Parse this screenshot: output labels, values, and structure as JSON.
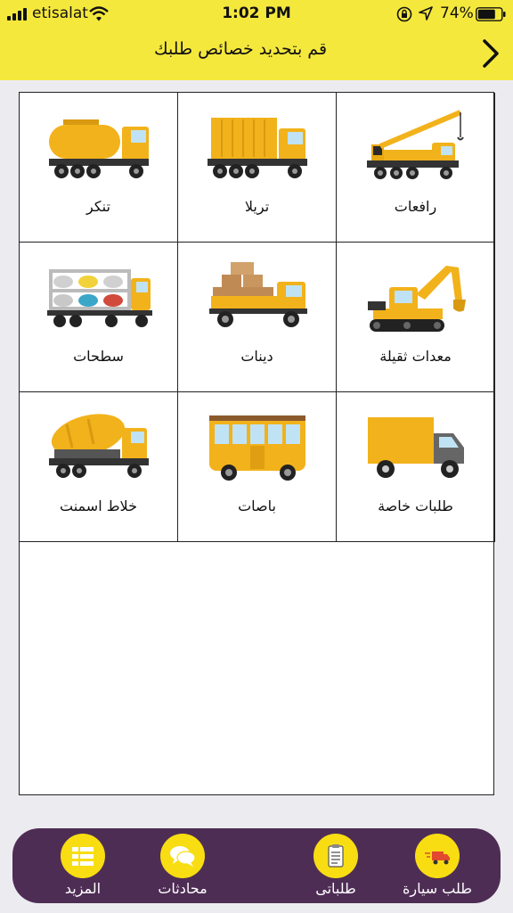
{
  "status_bar": {
    "carrier": "etisalat",
    "time": "1:02 PM",
    "battery": "74%"
  },
  "nav": {
    "title": "قم بتحديد خصائص طلبك",
    "back_icon": "chevron-right-icon"
  },
  "categories": [
    {
      "label": "رافعات",
      "icon": "crane-truck-icon"
    },
    {
      "label": "تريلا",
      "icon": "dump-truck-icon"
    },
    {
      "label": "تنكر",
      "icon": "tanker-truck-icon"
    },
    {
      "label": "معدات ثقيلة",
      "icon": "excavator-icon"
    },
    {
      "label": "دينات",
      "icon": "cargo-truck-icon"
    },
    {
      "label": "سطحات",
      "icon": "car-carrier-icon"
    },
    {
      "label": "طلبات خاصة",
      "icon": "delivery-van-icon"
    },
    {
      "label": "باصات",
      "icon": "bus-icon"
    },
    {
      "label": "خلاط اسمنت",
      "icon": "cement-mixer-icon"
    }
  ],
  "tabs": [
    {
      "label": "طلب سيارة",
      "icon": "truck-order-icon"
    },
    {
      "label": "طلباتى",
      "icon": "clipboard-icon"
    },
    {
      "label": "محادثات",
      "icon": "chat-bubbles-icon"
    },
    {
      "label": "المزيد",
      "icon": "more-list-icon"
    }
  ],
  "colors": {
    "header": "#f5e83d",
    "tabbar": "#4e2d55",
    "accent": "#f8dd12",
    "vehicle": "#f2b21b"
  }
}
